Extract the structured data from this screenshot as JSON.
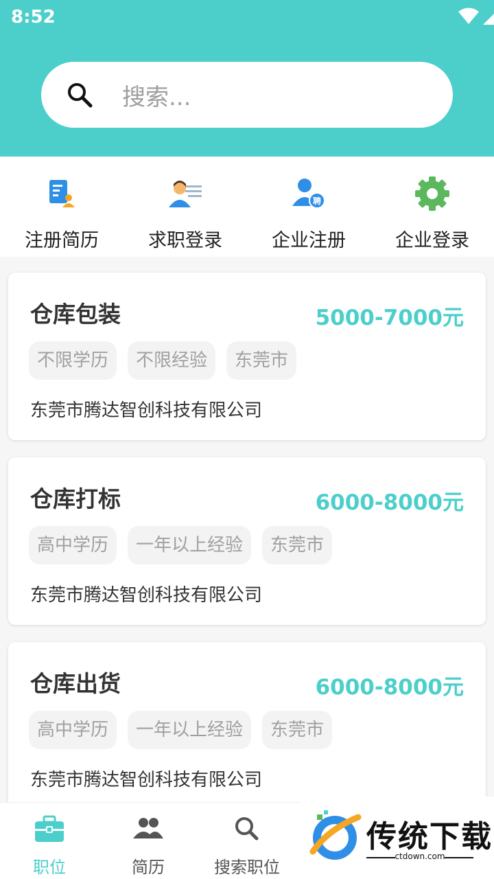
{
  "status_bar": {
    "time": "8:52"
  },
  "search": {
    "placeholder": "搜索..."
  },
  "quick_nav": [
    {
      "label": "注册简历",
      "icon": "resume-icon"
    },
    {
      "label": "求职登录",
      "icon": "job-seeker-icon"
    },
    {
      "label": "企业注册",
      "icon": "company-register-icon"
    },
    {
      "label": "企业登录",
      "icon": "gear-icon"
    }
  ],
  "jobs": [
    {
      "title": "仓库包装",
      "salary": "5000-7000元",
      "tags": [
        "不限学历",
        "不限经验",
        "东莞市"
      ],
      "company": "东莞市腾达智创科技有限公司"
    },
    {
      "title": "仓库打标",
      "salary": "6000-8000元",
      "tags": [
        "高中学历",
        "一年以上经验",
        "东莞市"
      ],
      "company": "东莞市腾达智创科技有限公司"
    },
    {
      "title": "仓库出货",
      "salary": "6000-8000元",
      "tags": [
        "高中学历",
        "一年以上经验",
        "东莞市"
      ],
      "company": "东莞市腾达智创科技有限公司"
    }
  ],
  "recruit_badge": "聘",
  "bottom_nav": [
    {
      "label": "职位",
      "icon": "briefcase-icon",
      "active": true
    },
    {
      "label": "简历",
      "icon": "people-icon",
      "active": false
    },
    {
      "label": "搜索职位",
      "icon": "search-icon",
      "active": false
    }
  ],
  "watermark": {
    "title": "传统下载",
    "subtitle": "ctdown.com"
  },
  "colors": {
    "accent": "#4ccfcb",
    "icon_blue": "#2f8fe6",
    "gear_green": "#5cb85c",
    "person_orange": "#f5a623"
  }
}
